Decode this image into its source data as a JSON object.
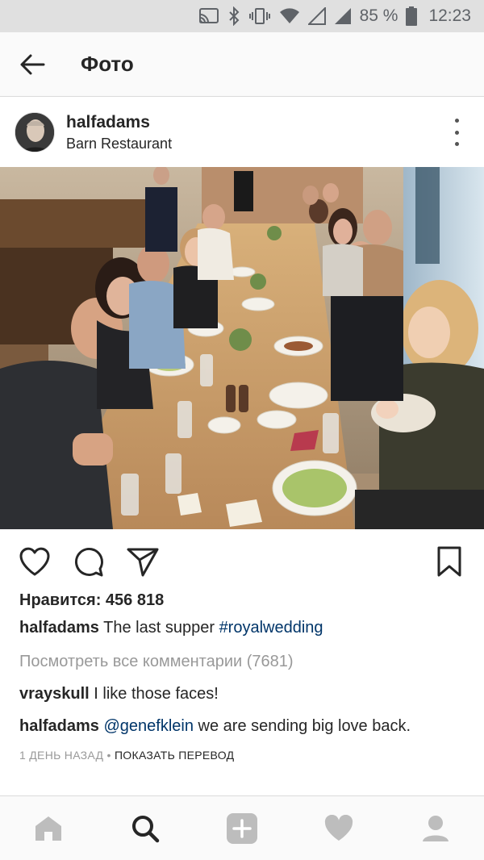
{
  "status_bar": {
    "battery_percent": "85 %",
    "time": "12:23",
    "icons": [
      "cast-icon",
      "bluetooth-icon",
      "vibrate-icon",
      "wifi-icon",
      "signal-empty-icon",
      "signal-icon",
      "battery-icon"
    ]
  },
  "header": {
    "back_icon": "arrow-left-icon",
    "title": "Фото"
  },
  "post": {
    "username": "halfadams",
    "location": "Barn Restaurant",
    "photo_icon": "group-dinner-photo",
    "likes": "Нравится: 456 818",
    "caption": {
      "username": "halfadams",
      "text": "The last supper",
      "hashtag": "#royalwedding"
    },
    "view_all_comments": "Посмотреть все комментарии (7681)",
    "comments": [
      {
        "username": "vrayskull",
        "text": "I like those faces!"
      },
      {
        "username": "halfadams",
        "mention": "@genefklein",
        "text": "we are sending big love back."
      }
    ],
    "time_ago": "1 ДЕНЬ НАЗАД",
    "separator": "•",
    "translate": "ПОКАЗАТЬ ПЕРЕВОД"
  },
  "actions": {
    "icons": [
      "heart-icon",
      "comment-icon",
      "share-icon",
      "bookmark-icon"
    ]
  },
  "bottom_nav": {
    "items": [
      "home-icon",
      "search-icon",
      "add-icon",
      "activity-heart-icon",
      "profile-icon"
    ],
    "active": "search-icon"
  },
  "colors": {
    "link": "#003569",
    "muted": "#999999",
    "text": "#262626",
    "status_bar_bg": "#e0e0e0"
  }
}
